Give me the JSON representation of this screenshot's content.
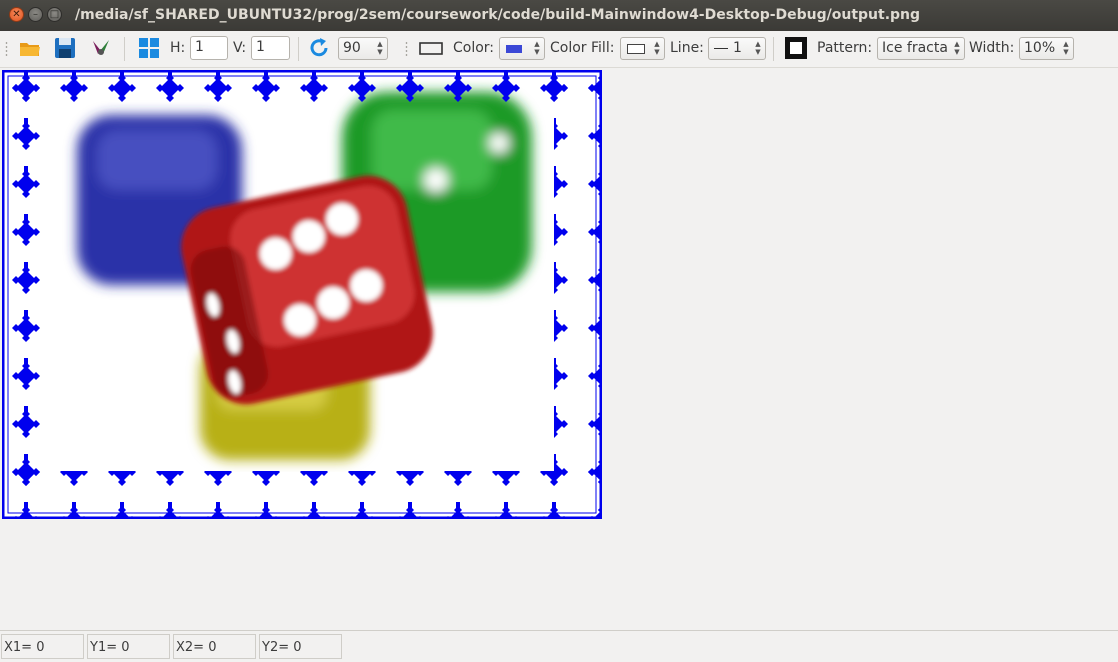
{
  "window": {
    "title": "/media/sf_SHARED_UBUNTU32/prog/2sem/coursework/code/build-Mainwindow4-Desktop-Debug/output.png"
  },
  "toolbar": {
    "h_label": "H:",
    "h_value": "1",
    "v_label": "V:",
    "v_value": "1",
    "rotate_value": "90",
    "color_label": "Color:",
    "color_value": "#3b48d6",
    "fill_label": "Color Fill:",
    "line_label": "Line:",
    "line_value": "1",
    "pattern_label": "Pattern:",
    "pattern_value": "Ice fracta",
    "width_label": "Width:",
    "width_value": "10%"
  },
  "status": {
    "x1": "X1= 0",
    "y1": "Y1= 0",
    "x2": "X2= 0",
    "y2": "Y2= 0"
  }
}
